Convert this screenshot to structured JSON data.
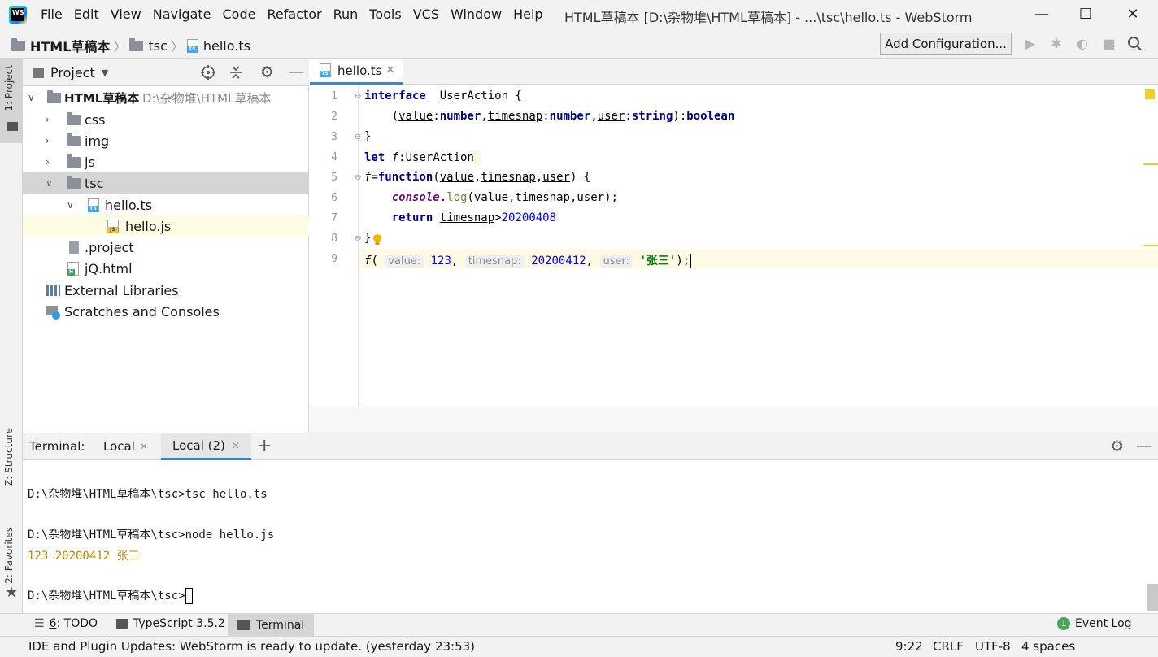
{
  "window": {
    "title": "HTML草稿本 [D:\\杂物堆\\HTML草稿本] - ...\\tsc\\hello.ts - WebStorm",
    "logo_text": "WS",
    "minimize": "—",
    "maximize": "☐",
    "close": "✕"
  },
  "menu": [
    "File",
    "Edit",
    "View",
    "Navigate",
    "Code",
    "Refactor",
    "Run",
    "Tools",
    "VCS",
    "Window",
    "Help"
  ],
  "breadcrumb": {
    "project": "HTML草稿本",
    "folder": "tsc",
    "file": "hello.ts",
    "sep": "〉"
  },
  "toolbar": {
    "add_configuration": "Add Configuration..."
  },
  "left_strip": {
    "project_tab": "1: Project",
    "structure_tab": "Z: Structure",
    "favorites_tab": "2: Favorites"
  },
  "project_panel": {
    "title": "Project",
    "tree": [
      {
        "label": "HTML草稿本",
        "hint": "D:\\杂物堆\\HTML草稿本"
      },
      {
        "label": "css"
      },
      {
        "label": "img"
      },
      {
        "label": "js"
      },
      {
        "label": "tsc"
      },
      {
        "label": "hello.ts"
      },
      {
        "label": "hello.js"
      },
      {
        "label": ".project"
      },
      {
        "label": "jQ.html"
      },
      {
        "label": "External Libraries"
      },
      {
        "label": "Scratches and Consoles"
      }
    ]
  },
  "editor": {
    "tab_label": "hello.ts",
    "line_numbers": [
      "1",
      "2",
      "3",
      "4",
      "5",
      "6",
      "7",
      "8",
      "9"
    ],
    "code": {
      "l1_kw": "interface",
      "l1_rest": "  UserAction {",
      "l2_open": "    (",
      "l2_value": "value",
      "l2_number1": "number",
      "l2_timesnap": "timesnap",
      "l2_number2": "number",
      "l2_user": "user",
      "l2_string": "string",
      "l2_boolean": "boolean",
      "l3": "}",
      "l4_kw": "let",
      "l4_f": "f",
      "l4_rest": ":UserAction",
      "l5_f": "f",
      "l5_kw": "function",
      "l5_value": "value",
      "l5_timesnap": "timesnap",
      "l5_user": "user",
      "l6_console": "console",
      "l6_log": "log",
      "l6_value": "value",
      "l6_timesnap": "timesnap",
      "l6_user": "user",
      "l7_kw": "return",
      "l7_timesnap": "timesnap",
      "l7_num": "20200408",
      "l8": "}",
      "l9_f": "f",
      "l9_hint_value": "value:",
      "l9_arg1": "123",
      "l9_hint_timesnap": "timesnap:",
      "l9_arg2": "20200412",
      "l9_hint_user": "user:",
      "l9_arg3": "'张三'",
      "l9_end": ");"
    }
  },
  "terminal": {
    "label": "Terminal:",
    "tabs": [
      "Local",
      "Local (2)"
    ],
    "add": "+",
    "lines": [
      "D:\\杂物堆\\HTML草稿本\\tsc>tsc hello.ts",
      "D:\\杂物堆\\HTML草稿本\\tsc>node hello.js",
      "123 20200412 张三",
      "D:\\杂物堆\\HTML草稿本\\tsc>"
    ]
  },
  "bottom_tools": {
    "todo_num": "6",
    "todo": ": TODO",
    "typescript": "TypeScript 3.5.2",
    "terminal": "Terminal",
    "event_log_badge": "1",
    "event_log": "Event Log"
  },
  "status": {
    "message": "IDE and Plugin Updates: WebStorm is ready to update. (yesterday 23:53)",
    "position": "9:22",
    "line_sep": "CRLF",
    "encoding": "UTF-8",
    "indent": "4 spaces"
  },
  "colors": {
    "accent": "#4083c9",
    "keyword": "#000080",
    "number": "#0000ff",
    "string": "#067d17",
    "terminal_output": "#b8860b"
  }
}
